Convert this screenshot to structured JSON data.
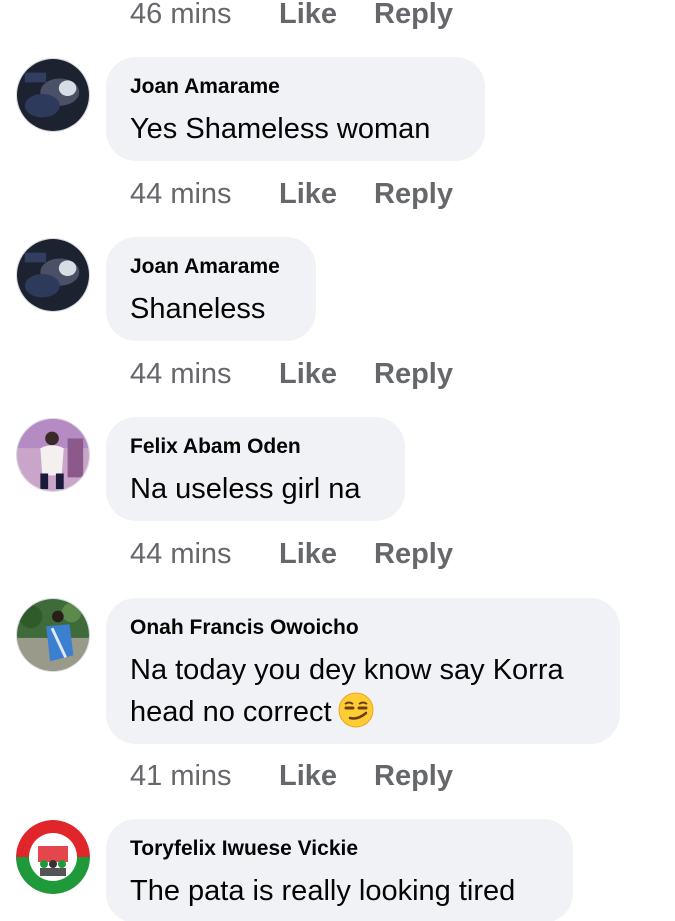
{
  "actions": {
    "like": "Like",
    "reply": "Reply"
  },
  "top_meta": {
    "time": "46 mins"
  },
  "comments": [
    {
      "author": "Joan Amarame",
      "text": "Yes Shameless woman",
      "time": "44 mins",
      "avatar": "person-photo-dark-blue"
    },
    {
      "author": "Joan Amarame",
      "text": "Shaneless",
      "time": "44 mins",
      "avatar": "person-photo-dark-blue"
    },
    {
      "author": "Felix Abam Oden",
      "text": "Na useless girl na",
      "time": "44 mins",
      "avatar": "person-photo-purple"
    },
    {
      "author": "Onah Francis Owoicho",
      "text_line1": "Na today you dey know say Korra",
      "text_line2": "head no correct",
      "emoji": "smirking-face-emoji",
      "time": "41 mins",
      "avatar": "person-photo-green"
    },
    {
      "author": "Toryfelix Iwuese Vickie",
      "text": "The pata is really looking tired",
      "avatar": "labour-party-logo"
    }
  ],
  "colors": {
    "bubble": "#f0f2f5",
    "meta_text": "#65676b",
    "text": "#050505",
    "logo_red": "#e0262b",
    "logo_green": "#1f9a3b"
  }
}
